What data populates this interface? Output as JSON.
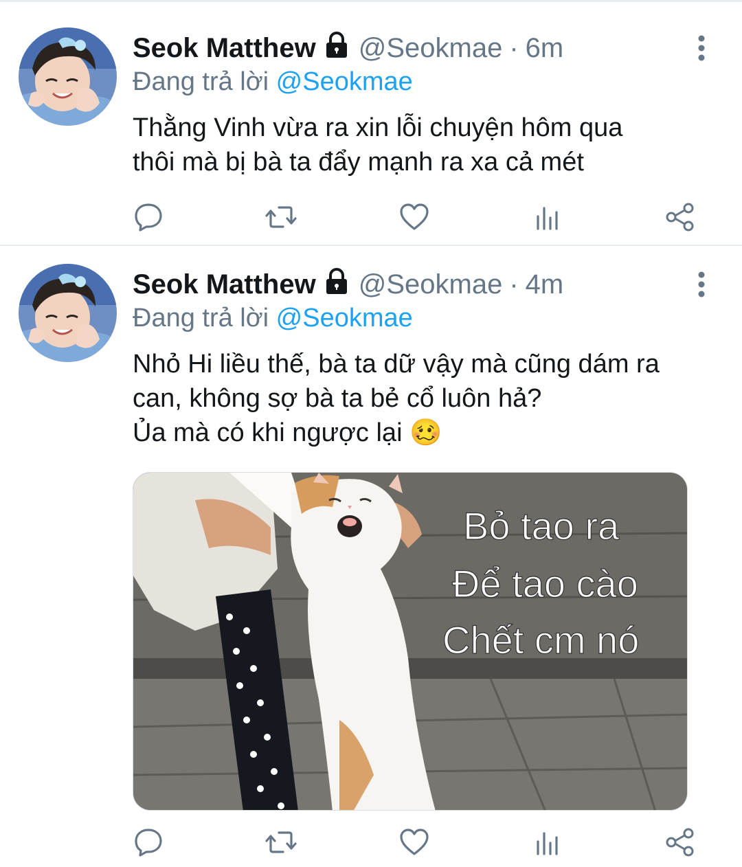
{
  "tweets": [
    {
      "author_name": "Seok Matthew",
      "handle": "@Seokmae",
      "separator": "·",
      "time": "6m",
      "reply_prefix": "Đang trả lời",
      "reply_mention": "@Seokmae",
      "text_lines": [
        "Thằng Vinh vừa ra xin lỗi chuyện hôm qua",
        "thôi mà bị bà ta đẩy mạnh ra xa cả mét"
      ],
      "icons": {
        "avatar": "profile-photo",
        "lock": "lock-icon",
        "more": "more-vertical-icon"
      }
    },
    {
      "author_name": "Seok Matthew",
      "handle": "@Seokmae",
      "separator": "·",
      "time": "4m",
      "reply_prefix": "Đang trả lời",
      "reply_mention": "@Seokmae",
      "text_lines": [
        "Nhỏ Hi liều thế, bà ta dữ vậy mà cũng dám ra",
        "can, không sợ bà ta bẻ cổ luôn hả?",
        "Ủa mà có khi ngược lại 🥴"
      ],
      "media": {
        "kind": "meme-image",
        "caption_lines": [
          "Bỏ tao ra",
          "Để tao cào",
          "Chết cm nó"
        ]
      },
      "icons": {
        "avatar": "profile-photo",
        "lock": "lock-icon",
        "more": "more-vertical-icon"
      }
    }
  ],
  "actions": [
    "reply-icon",
    "retweet-icon",
    "like-icon",
    "analytics-icon",
    "share-icon"
  ],
  "colors": {
    "text": "#14171a",
    "secondary": "#657786",
    "link": "#1da1f2",
    "divider": "#e6ecf0"
  }
}
